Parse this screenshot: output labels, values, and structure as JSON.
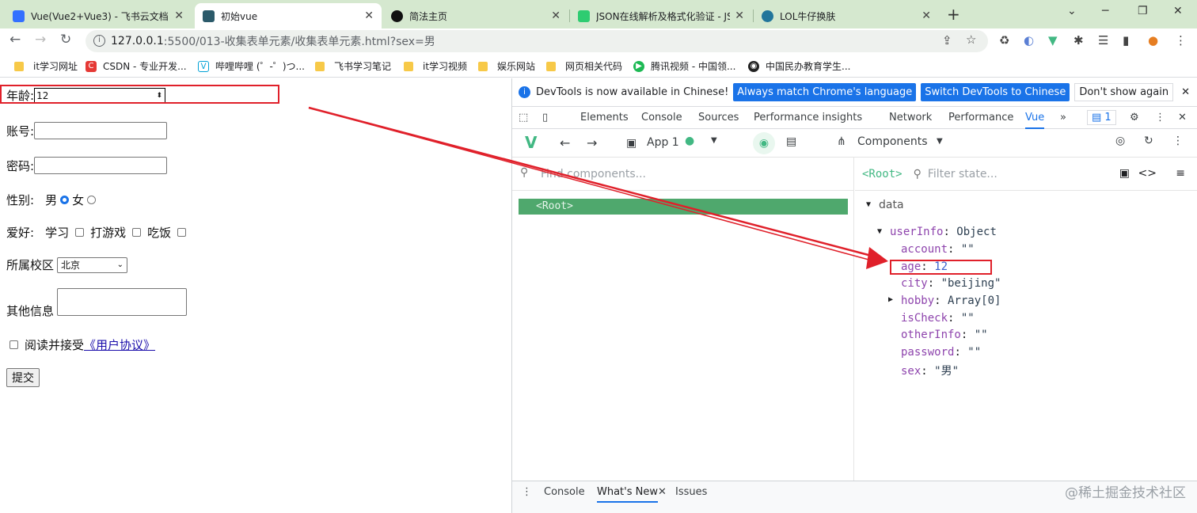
{
  "tabs": [
    {
      "title": "Vue(Vue2+Vue3) - 飞书云文档",
      "icon": "docs-icon",
      "color": "#3370ff"
    },
    {
      "title": "初始vue",
      "icon": "vscode-icon",
      "color": "#2b5a6a"
    },
    {
      "title": "简法主页",
      "icon": "jianfa-icon",
      "color": "#111111"
    },
    {
      "title": "JSON在线解析及格式化验证 - JS",
      "icon": "json-icon",
      "color": "#2ecc71"
    },
    {
      "title": "LOL牛仔换肤",
      "icon": "wordpress-icon",
      "color": "#21759b"
    }
  ],
  "address": {
    "host": "127.0.0.1",
    "path": ":5500/013-收集表单元素/收集表单元素.html?sex=男"
  },
  "bookmarks": [
    "it学习网址",
    "CSDN - 专业开发...",
    "哔哩哔哩 (゜-゜)つ...",
    "飞书学习笔记",
    "it学习视频",
    "娱乐网站",
    "网页相关代码",
    "腾讯视频 - 中国领...",
    "中国民办教育学生..."
  ],
  "form": {
    "age_label": "年龄:",
    "age_value": "12",
    "account_label": "账号:",
    "password_label": "密码:",
    "sex_label": "性别:",
    "male": "男",
    "female": "女",
    "hobby_label": "爱好:",
    "hobby1": "学习",
    "hobby2": "打游戏",
    "hobby3": "吃饭",
    "campus_label": "所属校区",
    "campus_value": "北京",
    "other_label": "其他信息",
    "agree_text": "阅读并接受",
    "agree_link": "《用户协议》",
    "submit": "提交"
  },
  "devtools": {
    "info_text": "DevTools is now available in Chinese!",
    "btn_match": "Always match Chrome's language",
    "btn_switch": "Switch DevTools to Chinese",
    "btn_dismiss": "Don't show again",
    "tabs": [
      "Elements",
      "Console",
      "Sources",
      "Performance insights",
      "Network",
      "Performance",
      "Vue"
    ],
    "issues_count": "1",
    "app_label": "App 1",
    "components_label": "Components",
    "find_placeholder": "Find components...",
    "root_node": "<Root>",
    "state_root": "<Root>",
    "filter_placeholder": "Filter state...",
    "data_label": "data",
    "state": {
      "userInfo": "userInfo",
      "userInfo_type": "Object",
      "account": "account",
      "account_val": "\"\"",
      "age": "age",
      "age_val": "12",
      "city": "city",
      "city_val": "\"beijing\"",
      "hobby": "hobby",
      "hobby_val": "Array[0]",
      "isCheck": "isCheck",
      "isCheck_val": "\"\"",
      "otherInfo": "otherInfo",
      "otherInfo_val": "\"\"",
      "password": "password",
      "password_val": "\"\"",
      "sex": "sex",
      "sex_val": "\"男\""
    },
    "drawer_tabs": [
      "Console",
      "What's New",
      "Issues"
    ]
  },
  "watermark": "@稀土掘金技术社区"
}
